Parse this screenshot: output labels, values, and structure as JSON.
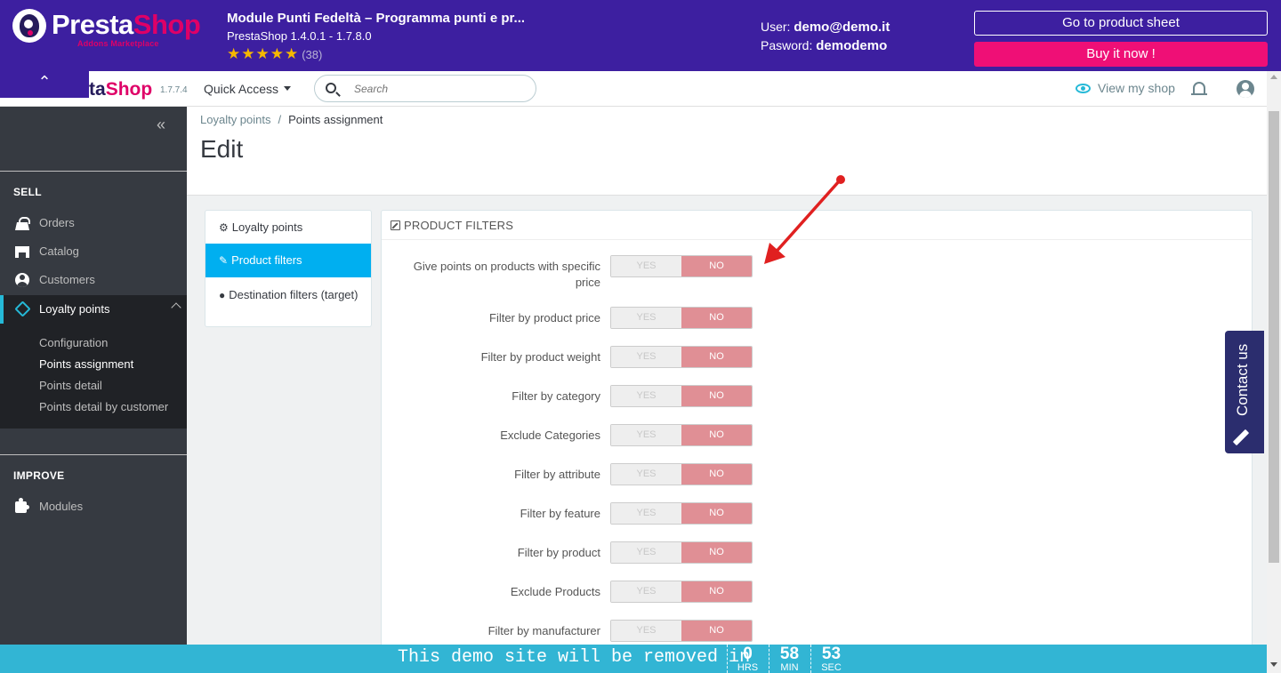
{
  "banner": {
    "logo_presta": "Presta",
    "logo_shop": "Shop",
    "logo_sub": "Addons Marketplace",
    "module_title": "Module Punti Fedeltà – Programma punti e pr...",
    "module_version": "PrestaShop 1.4.0.1 - 1.7.8.0",
    "stars": "★★★★★",
    "rating_count": "(38)",
    "user_label": "User:",
    "user_value": "demo@demo.it",
    "password_label": "Pasword:",
    "password_value": "demodemo",
    "product_sheet_button": "Go to product sheet",
    "buy_button": "Buy it now !"
  },
  "header": {
    "collapse_glyph": "⌃",
    "logo_text": "ta",
    "logo_shop": "Shop",
    "version": "1.7.7.4",
    "quick_access": "Quick Access",
    "search_placeholder": "Search",
    "view_shop": "View my shop"
  },
  "sidebar": {
    "collapse_glyph": "«",
    "section_sell": "SELL",
    "items": [
      {
        "label": "Orders",
        "icon": "basket-icon"
      },
      {
        "label": "Catalog",
        "icon": "store-icon"
      },
      {
        "label": "Customers",
        "icon": "account-icon"
      },
      {
        "label": "Loyalty points",
        "icon": "tag-icon"
      }
    ],
    "submenu": [
      "Configuration",
      "Points assignment",
      "Points detail",
      "Points detail by customer"
    ],
    "section_improve": "IMPROVE",
    "modules": "Modules"
  },
  "breadcrumb": {
    "parent": "Loyalty points",
    "separator": "/",
    "current": "Points assignment"
  },
  "page_title": "Edit",
  "tabs": [
    {
      "label": "Loyalty points",
      "icon": "gears-icon",
      "glyph": "⚙"
    },
    {
      "label": "Product filters",
      "icon": "edit-icon",
      "glyph": "✎"
    },
    {
      "label": "Destination filters (target)",
      "icon": "globe-icon",
      "glyph": "●"
    }
  ],
  "panel": {
    "heading": "PRODUCT FILTERS",
    "yes_label": "YES",
    "no_label": "NO",
    "filters": [
      {
        "label": "Give points on products with specific price",
        "value": "NO"
      },
      {
        "label": "Filter by product price",
        "value": "NO"
      },
      {
        "label": "Filter by product weight",
        "value": "NO"
      },
      {
        "label": "Filter by category",
        "value": "NO"
      },
      {
        "label": "Exclude Categories",
        "value": "NO"
      },
      {
        "label": "Filter by attribute",
        "value": "NO"
      },
      {
        "label": "Filter by feature",
        "value": "NO"
      },
      {
        "label": "Filter by product",
        "value": "NO"
      },
      {
        "label": "Exclude Products",
        "value": "NO"
      },
      {
        "label": "Filter by manufacturer",
        "value": "NO"
      }
    ]
  },
  "contact_tab": "Contact us",
  "countdown": {
    "message": "This demo site will be removed in",
    "hours": "0",
    "hours_unit": "HRS",
    "minutes": "58",
    "minutes_unit": "MIN",
    "seconds": "53",
    "seconds_unit": "SEC"
  },
  "colors": {
    "banner_bg": "#3d1fa0",
    "buy_button": "#ef0f76",
    "active_tab": "#00aff0",
    "switch_no": "#e08f95",
    "countdown_bg": "#32b5d4",
    "sidebar_bg": "#363a41"
  }
}
